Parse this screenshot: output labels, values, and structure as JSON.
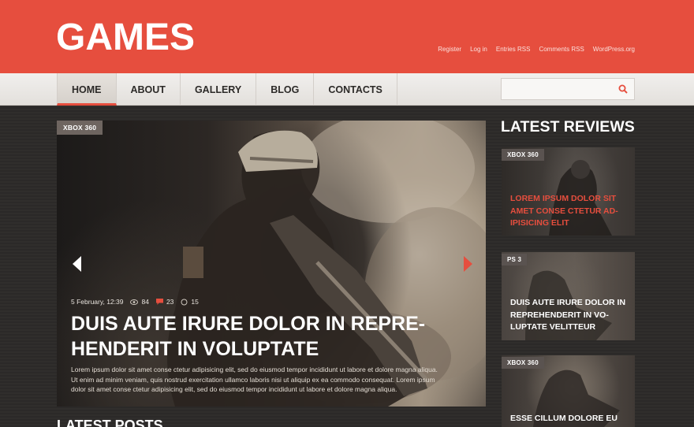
{
  "header": {
    "logo": "GAMES",
    "links": [
      "Register",
      "Log in",
      "Entries RSS",
      "Comments RSS",
      "WordPress.org"
    ]
  },
  "nav": {
    "items": [
      "HOME",
      "ABOUT",
      "GALLERY",
      "BLOG",
      "CONTACTS"
    ],
    "active_index": 0
  },
  "search": {
    "placeholder": "",
    "icon": "search-icon"
  },
  "slider": {
    "tag": "XBOX 360",
    "date": "5 February, 12:39",
    "views": "84",
    "comments": "23",
    "shares": "15",
    "title": "Duis aute irure dolor in repre- henderit in voluptate",
    "text": "Lorem ipsum dolor sit amet conse ctetur adipisicing elit, sed do eiusmod tempor incididunt ut labore et dolore magna aliqua. Ut enim ad minim veniam, quis nostrud exercitation ullamco laboris nisi ut aliquip ex ea commodo consequat. Lorem ipsum dolor sit amet conse ctetur adipisicing elit, sed do eiusmod tempor incididunt ut labore et dolore magna aliqua.",
    "prev_icon": "chevron-left-icon",
    "next_icon": "chevron-right-icon"
  },
  "latest_posts": {
    "heading": "LATEST POSTS"
  },
  "sidebar": {
    "heading": "LATEST REVIEWS",
    "reviews": [
      {
        "tag": "XBOX 360",
        "title": "Lorem ipsum dolor sit amet conse ctetur ad- ipisicing elit",
        "color": "#e64e3e"
      },
      {
        "tag": "PS 3",
        "title": "Duis aute irure dolor in reprehenderit in vo- luptate velitteur",
        "color": "#ffffff"
      },
      {
        "tag": "XBOX 360",
        "title": "Esse cillum dolore eu",
        "color": "#ffffff"
      }
    ]
  },
  "colors": {
    "accent": "#e64e3e",
    "nav_bg": "#ebe8e5",
    "body_bg": "#2a2827"
  }
}
